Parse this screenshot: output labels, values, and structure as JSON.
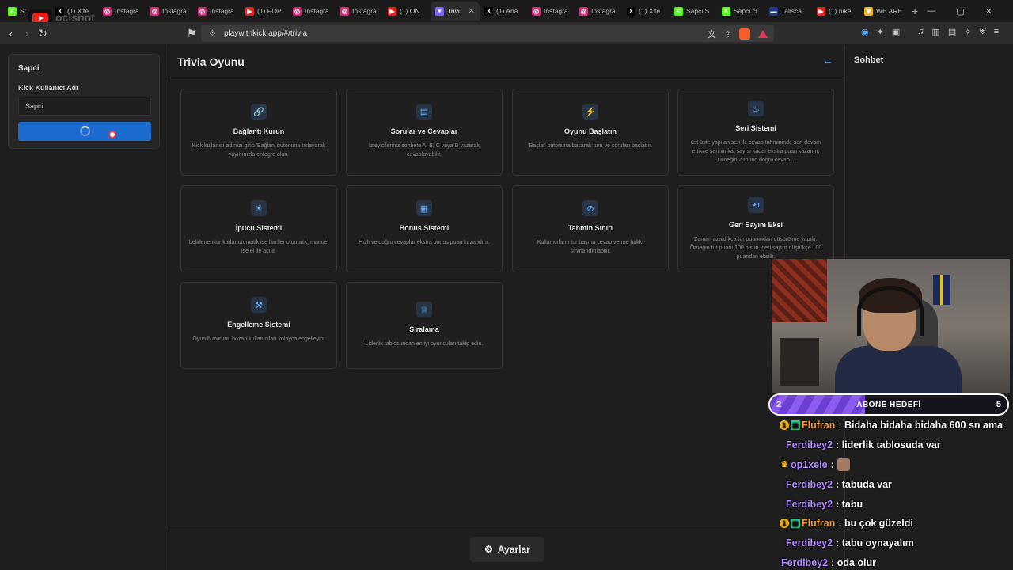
{
  "browser": {
    "tabs": [
      {
        "title": "St",
        "favicon_color": "#53fc18",
        "favicon_glyph": "K"
      },
      {
        "title": "(1) X'te",
        "favicon_color": "#000000",
        "favicon_glyph": "X"
      },
      {
        "title": "Instagra",
        "favicon_color": "#d62976",
        "favicon_glyph": "◎"
      },
      {
        "title": "Instagra",
        "favicon_color": "#d62976",
        "favicon_glyph": "◎"
      },
      {
        "title": "Instagra",
        "favicon_color": "#d62976",
        "favicon_glyph": "◎"
      },
      {
        "title": "(1) POP",
        "favicon_color": "#e62117",
        "favicon_glyph": "▶"
      },
      {
        "title": "Instagra",
        "favicon_color": "#d62976",
        "favicon_glyph": "◎"
      },
      {
        "title": "Instagra",
        "favicon_color": "#d62976",
        "favicon_glyph": "◎"
      },
      {
        "title": "(1) ON",
        "favicon_color": "#e62117",
        "favicon_glyph": "▶"
      },
      {
        "title": "Trivi",
        "favicon_color": "#7b61ff",
        "favicon_glyph": "▼",
        "active": true
      },
      {
        "title": "(1) Ana",
        "favicon_color": "#000000",
        "favicon_glyph": "X"
      },
      {
        "title": "Instagra",
        "favicon_color": "#d62976",
        "favicon_glyph": "◎"
      },
      {
        "title": "Instagra",
        "favicon_color": "#d62976",
        "favicon_glyph": "◎"
      },
      {
        "title": "(1) X'te",
        "favicon_color": "#000000",
        "favicon_glyph": "X"
      },
      {
        "title": "Sapci S",
        "favicon_color": "#53fc18",
        "favicon_glyph": "K"
      },
      {
        "title": "Sapci cl",
        "favicon_color": "#53fc18",
        "favicon_glyph": "K"
      },
      {
        "title": "Talisca",
        "favicon_color": "#1b3a8a",
        "favicon_glyph": "▬"
      },
      {
        "title": "(1) nike",
        "favicon_color": "#e62117",
        "favicon_glyph": "▶"
      },
      {
        "title": "WE ARE",
        "favicon_color": "#f2b01e",
        "favicon_glyph": "♛"
      }
    ],
    "new_tab": "+",
    "url": "playwithkick.app/#/trivia",
    "watermark": "ocisnot"
  },
  "left_panel": {
    "title": "Sapci",
    "username_label": "Kick Kullanıcı Adı",
    "username_value": "Sapci"
  },
  "main": {
    "title": "Trivia Oyunu",
    "cards": [
      {
        "icon": "link-icon",
        "glyph": "🔗",
        "title": "Bağlantı Kurun",
        "desc": "Kick kullanıcı adınızı girip 'Bağlan' butonuna tıklayarak yayınınızla entegre olun."
      },
      {
        "icon": "chat-icon",
        "glyph": "▤",
        "title": "Sorular ve Cevaplar",
        "desc": "İzleyicileriniz sohbete A, B, C veya D yazarak cevaplayabilir."
      },
      {
        "icon": "lightning-icon",
        "glyph": "⚡",
        "title": "Oyunu Başlatın",
        "desc": "'Başlat' butonuna basarak turu ve soruları başlatın."
      },
      {
        "icon": "flame-icon",
        "glyph": "♨",
        "title": "Seri Sistemi",
        "desc": "üst üste yapılan seri ile cevap tahmininde seri devam ettikçe serinin kat sayısı kadar ekstra puan kazanın. Örneğin 2 round doğru cevap..."
      },
      {
        "icon": "lightbulb-icon",
        "glyph": "☀",
        "title": "İpucu Sistemi",
        "desc": "belirlenen tur kadar otomatik ise harfler otomatik, manuel ise el ile açılır."
      },
      {
        "icon": "gift-icon",
        "glyph": "▦",
        "title": "Bonus Sistemi",
        "desc": "Hızlı ve doğru cevaplar ekstra bonus puan kazandırır."
      },
      {
        "icon": "ban-icon",
        "glyph": "⊘",
        "title": "Tahmin Sınırı",
        "desc": "Kullanıcıların tur başına cevap verme hakkı sınırlandırılabilir."
      },
      {
        "icon": "history-icon",
        "glyph": "⟲",
        "title": "Geri Sayım Eksi",
        "desc": "Zaman azaldıkça tur puanından düşürülme yapılır. Örneğin tur puanı 100 olsun, geri sayım düştükçe 100 puandan eksilir."
      },
      {
        "icon": "user-block-icon",
        "glyph": "⚒",
        "title": "Engelleme Sistemi",
        "desc": "Oyun huzurunu bozan kullanıcıları kolayca engelleyin."
      },
      {
        "icon": "trophy-icon",
        "glyph": "♕",
        "title": "Sıralama",
        "desc": "Liderlik tablosundan en iyi oyuncuları takip edin."
      }
    ],
    "settings_label": "Ayarlar"
  },
  "right_panel": {
    "title": "Sohbet"
  },
  "overlay": {
    "sub_goal": {
      "label": "ABONE HEDEFİ",
      "current": "2",
      "target": "5",
      "progress": 0.4
    },
    "chat": [
      {
        "badges": [
          "gold",
          "sq"
        ],
        "user": "Flufran",
        "color": "orange",
        "message": ": Bidaha bidaha bidaha 600 sn ama"
      },
      {
        "badges": [],
        "user": "Ferdibey2",
        "color": "purple",
        "message": ": liderlik tablosuda var"
      },
      {
        "badges": [
          "crown"
        ],
        "user": "op1xele",
        "color": "purple",
        "message": ":",
        "emote": true
      },
      {
        "badges": [],
        "user": "Ferdibey2",
        "color": "purple",
        "message": ": tabuda var"
      },
      {
        "badges": [],
        "user": "Ferdibey2",
        "color": "purple",
        "message": ": tabu"
      },
      {
        "badges": [
          "gold",
          "sq"
        ],
        "user": "Flufran",
        "color": "orange",
        "message": ": bu çok güzeldi"
      },
      {
        "badges": [],
        "user": "Ferdibey2",
        "color": "purple",
        "message": ": tabu oynayalım"
      },
      {
        "badges": [],
        "user": "Ferdibey2",
        "color": "purple",
        "message": ": oda olur"
      }
    ]
  }
}
